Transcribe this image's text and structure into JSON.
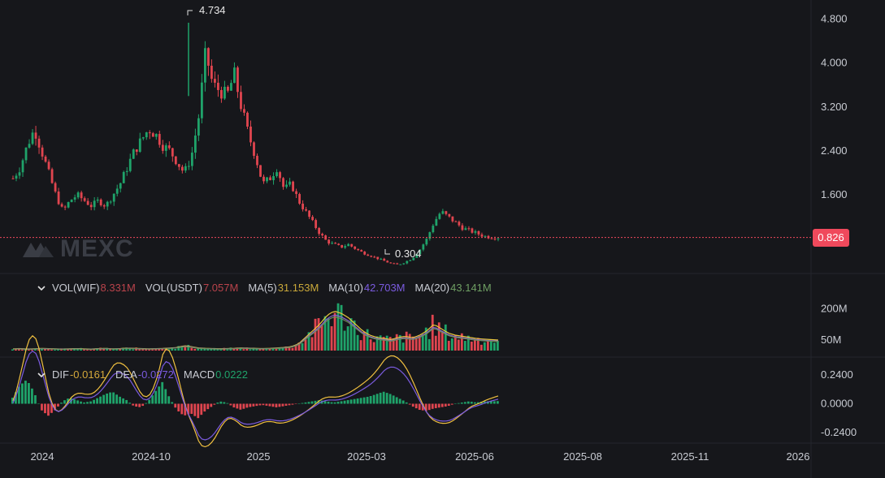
{
  "brand": {
    "watermark": "MEXC"
  },
  "colors": {
    "up": "#1fa36a",
    "down": "#e0454f",
    "last": "#f0495c",
    "ma5": "#e8c83d",
    "ma10": "#8a63d2",
    "ma20": "#6f8f5c",
    "dif": "#f0c040",
    "dea": "#7b5be0",
    "grid": "#22242a",
    "text": "#c9ccd3"
  },
  "price_labels": {
    "high": "4.734",
    "low": "0.304",
    "last": "0.826"
  },
  "volume_legend": {
    "items": [
      {
        "label": "VOL(WIF)",
        "value": "8.331M",
        "color": "#b9434b"
      },
      {
        "label": "VOL(USDT)",
        "value": "7.057M",
        "color": "#b9434b"
      },
      {
        "label": "MA(5)",
        "value": "31.153M",
        "color": "#c9a83a"
      },
      {
        "label": "MA(10)",
        "value": "42.703M",
        "color": "#7b5be0"
      },
      {
        "label": "MA(20)",
        "value": "43.141M",
        "color": "#6f9f63"
      }
    ]
  },
  "macd_legend": {
    "items": [
      {
        "label": "DIF",
        "value": "-0.0161",
        "color": "#d4a83a"
      },
      {
        "label": "DEA",
        "value": "-0.0272",
        "color": "#7b5be0"
      },
      {
        "label": "MACD",
        "value": "0.0222",
        "color": "#1fa36a"
      }
    ]
  },
  "chart_data": [
    {
      "type": "candlestick",
      "x_ticks": [
        "2024",
        "2024-10",
        "2025",
        "2025-03",
        "2025-06",
        "2025-08",
        "2025-11",
        "2026"
      ],
      "y_ticks": [
        "4.800",
        "4.000",
        "3.200",
        "2.400",
        "1.600"
      ],
      "ylim": [
        0.2,
        5.0
      ],
      "high": 4.734,
      "low": 0.304,
      "last": 0.826,
      "close_trend": [
        1.9,
        2.1,
        2.5,
        2.8,
        2.4,
        2.0,
        1.6,
        1.3,
        1.5,
        1.6,
        1.5,
        1.4,
        1.5,
        1.4,
        1.6,
        1.8,
        2.1,
        2.4,
        2.6,
        2.8,
        2.7,
        2.5,
        2.4,
        2.2,
        2.0,
        2.3,
        3.0,
        4.2,
        3.6,
        3.5,
        3.4,
        3.8,
        3.2,
        2.7,
        2.3,
        1.8,
        1.9,
        2.1,
        1.7,
        1.8,
        1.5,
        1.3,
        1.1,
        0.9,
        0.75,
        0.7,
        0.65,
        0.7,
        0.62,
        0.55,
        0.5,
        0.45,
        0.4,
        0.35,
        0.33,
        0.38,
        0.45,
        0.6,
        0.8,
        1.1,
        1.3,
        1.2,
        1.1,
        1.0,
        0.95,
        0.9,
        0.85,
        0.83,
        0.826
      ]
    },
    {
      "type": "bar",
      "name": "VOL",
      "y_ticks": [
        "200M",
        "50M"
      ],
      "ylim": [
        0,
        260
      ],
      "values": [
        8,
        9,
        7,
        8,
        10,
        9,
        8,
        7,
        8,
        9,
        8,
        7,
        9,
        10,
        8,
        9,
        11,
        10,
        9,
        8,
        9,
        10,
        12,
        14,
        22,
        18,
        12,
        10,
        9,
        8,
        9,
        10,
        12,
        11,
        10,
        9,
        10,
        12,
        14,
        18,
        30,
        60,
        90,
        120,
        160,
        180,
        170,
        150,
        120,
        90,
        70,
        60,
        55,
        50,
        60,
        65,
        58,
        70,
        90,
        120,
        100,
        80,
        70,
        65,
        60,
        55,
        52,
        50,
        48
      ]
    },
    {
      "type": "bar",
      "name": "MACD",
      "y_ticks": [
        "0.2400",
        "0.0000",
        "-0.2400"
      ],
      "ylim": [
        -0.32,
        0.32
      ],
      "values": [
        0.05,
        0.15,
        0.2,
        0.1,
        -0.05,
        -0.1,
        -0.05,
        0.02,
        0.05,
        0.03,
        0.01,
        0.02,
        0.05,
        0.08,
        0.1,
        0.06,
        0.03,
        -0.02,
        -0.03,
        0.02,
        0.1,
        0.18,
        0.05,
        -0.05,
        -0.1,
        -0.08,
        -0.12,
        -0.06,
        -0.02,
        0.02,
        0.01,
        -0.03,
        -0.05,
        -0.03,
        -0.02,
        -0.01,
        -0.02,
        -0.03,
        -0.02,
        -0.01,
        0.0,
        0.01,
        0.02,
        0.03,
        0.02,
        0.01,
        0.02,
        0.03,
        0.04,
        0.05,
        0.06,
        0.08,
        0.1,
        0.08,
        0.05,
        0.02,
        -0.02,
        -0.05,
        -0.06,
        -0.04,
        -0.03,
        -0.02,
        0.0,
        0.01,
        0.02,
        0.01,
        0.02,
        0.02,
        0.022
      ],
      "dif_last": -0.0161,
      "dea_last": -0.0272
    }
  ]
}
